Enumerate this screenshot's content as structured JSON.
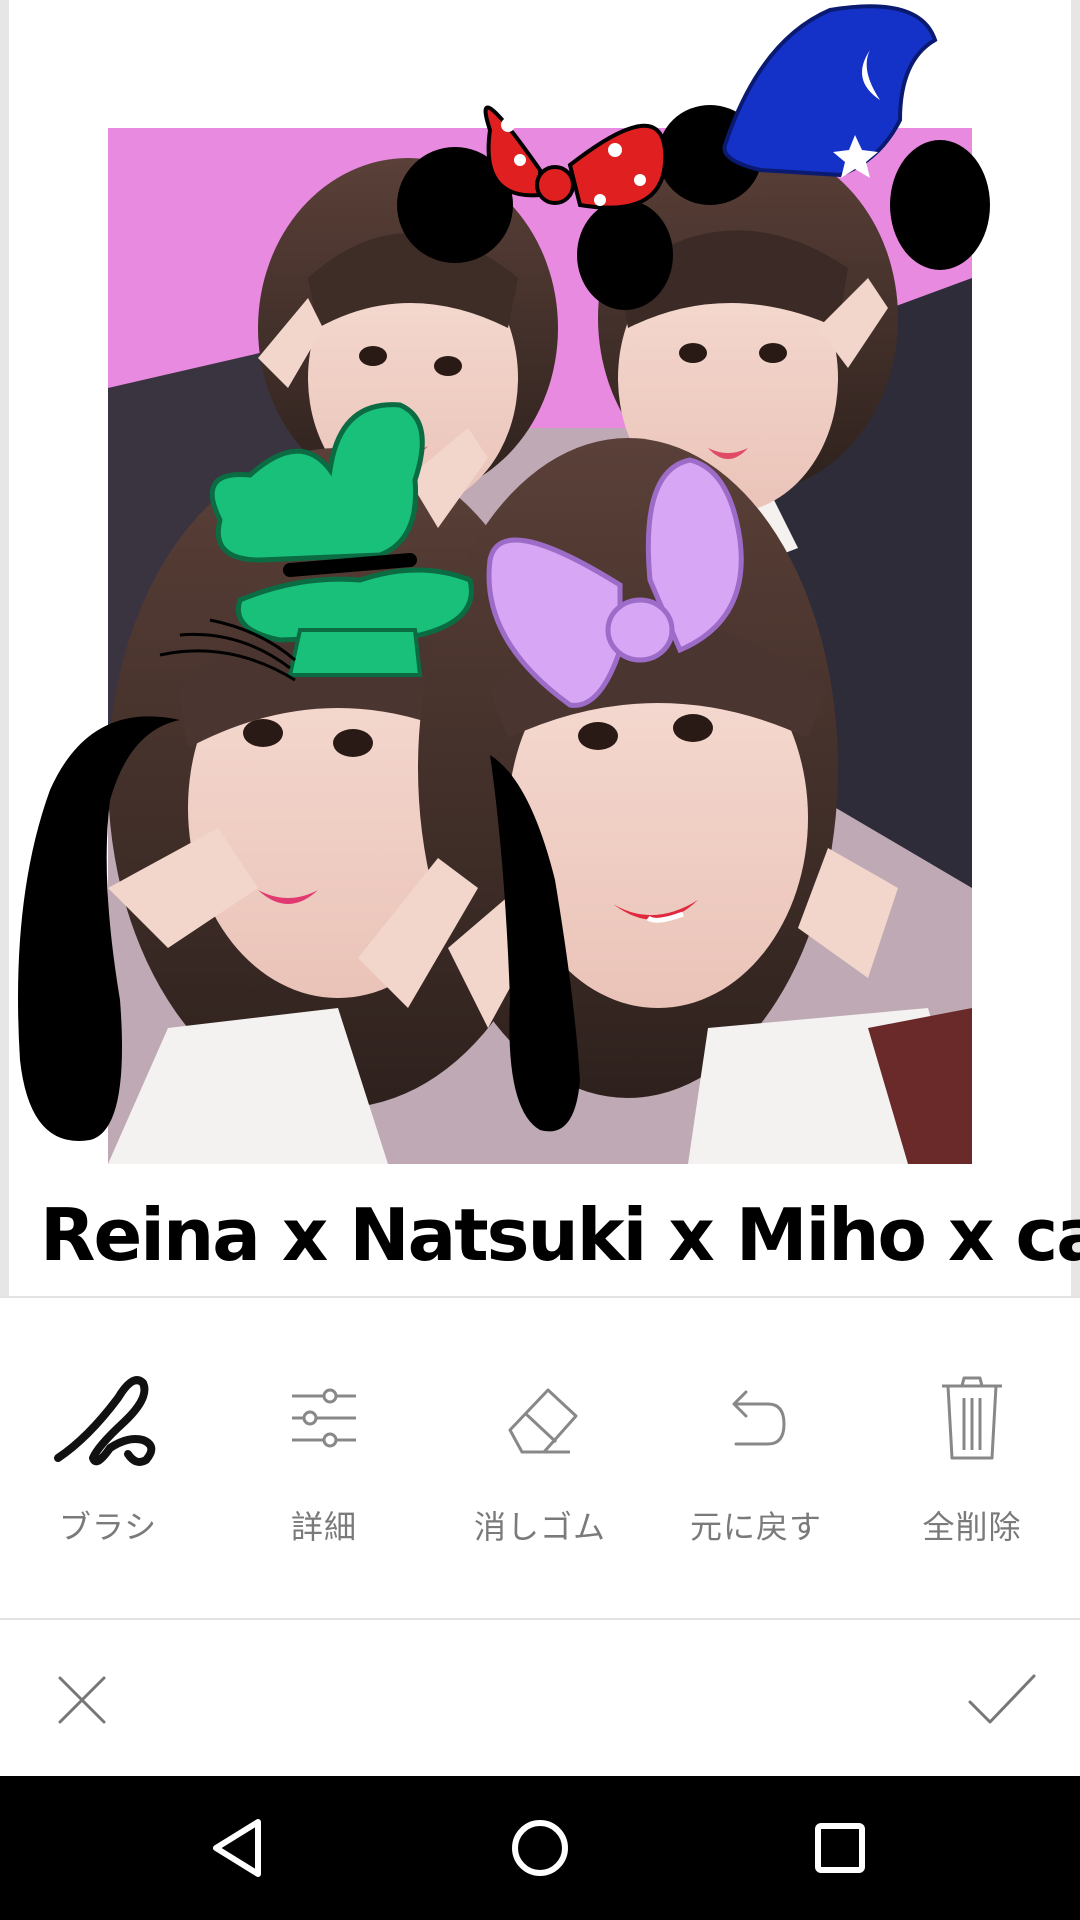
{
  "canvas": {
    "caption": "Reina x Natsuki x Miho x canon"
  },
  "tools": [
    {
      "label": "ブラシ",
      "icon": "brush-icon"
    },
    {
      "label": "詳細",
      "icon": "sliders-icon"
    },
    {
      "label": "消しゴム",
      "icon": "eraser-icon"
    },
    {
      "label": "元に戻す",
      "icon": "undo-icon"
    },
    {
      "label": "全削除",
      "icon": "trash-icon"
    }
  ],
  "actions": {
    "cancel_icon": "close-icon",
    "confirm_icon": "check-icon"
  },
  "navigation": {
    "back_icon": "back-triangle-icon",
    "home_icon": "home-circle-icon",
    "recent_icon": "recent-square-icon"
  },
  "colors": {
    "photo_backdrop": "#e88ae0",
    "toolbar_text": "#7a7a7a",
    "nav_background": "#000000"
  }
}
